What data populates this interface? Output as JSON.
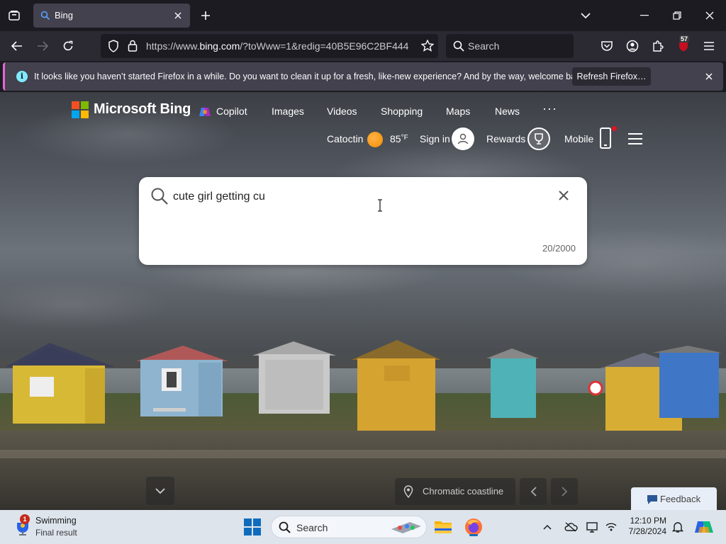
{
  "browser": {
    "tab_title": "Bing",
    "url_prefix": "https://www.",
    "url_host": "bing.com",
    "url_rest": "/?toWww=1&redig=40B5E96C2BF444",
    "search_placeholder": "Search",
    "extension_badge": "57"
  },
  "notification": {
    "message": "It looks like you haven’t started Firefox in a while. Do you want to clean it up for a fresh, like-new experience? And by the way, welcome back!",
    "button": "Refresh Firefox…"
  },
  "bing": {
    "brand": "Microsoft Bing",
    "nav": [
      "Copilot",
      "Images",
      "Videos",
      "Shopping",
      "Maps",
      "News"
    ],
    "more": "···",
    "location": "Catoctin",
    "temperature": "85",
    "temp_unit": "°F",
    "sign_in": "Sign in",
    "rewards": "Rewards",
    "mobile": "Mobile",
    "search_query": "cute girl getting cu",
    "char_counter": "20/2000",
    "image_location": "Chromatic coastline",
    "feedback": "Feedback"
  },
  "taskbar": {
    "weather_title": "Swimming",
    "weather_sub": "Final result",
    "weather_badge": "1",
    "search_placeholder": "Search",
    "time": "12:10 PM",
    "date": "7/28/2024"
  },
  "colors": {
    "firefox_dark": "#1c1b22",
    "toolbar": "#2b2a33",
    "notif_accent": "#e26ad6",
    "bing_blue": "#0f6cbd"
  }
}
